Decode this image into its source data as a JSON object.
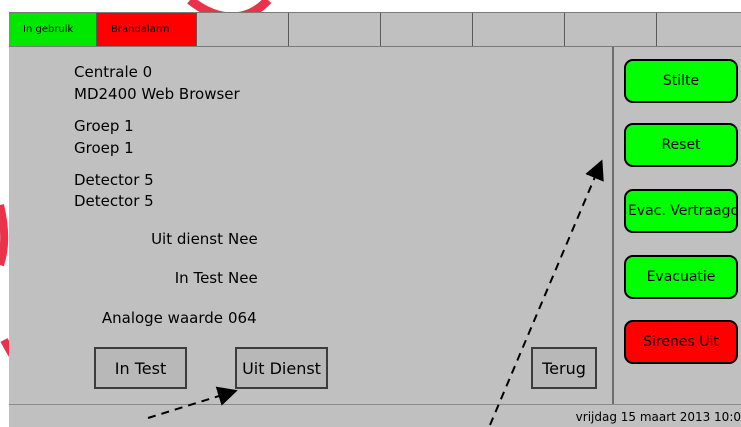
{
  "top_tabs": [
    {
      "label": "In gebruik",
      "color": "#00e800"
    },
    {
      "label": "Brandalarm",
      "color": "#ff0000"
    },
    {
      "label": ""
    },
    {
      "label": ""
    },
    {
      "label": ""
    },
    {
      "label": ""
    },
    {
      "label": ""
    },
    {
      "label": ""
    }
  ],
  "info": {
    "centrale": "Centrale 0",
    "browser": "MD2400 Web Browser",
    "group_line1": "Groep 1",
    "group_line2": "Groep 1",
    "detector_line1": "Detector 5",
    "detector_line2": "Detector 5"
  },
  "fields": {
    "uit_dienst_label": "Uit dienst",
    "uit_dienst_value": "Nee",
    "in_test_label": "In Test",
    "in_test_value": "Nee",
    "analoge_label": "Analoge waarde",
    "analoge_value": "064"
  },
  "buttons": {
    "in_test": "In Test",
    "uit_dienst": "Uit Dienst",
    "terug": "Terug"
  },
  "side_buttons": [
    {
      "label": "Stilte",
      "color": "#00ff00"
    },
    {
      "label": "Reset",
      "color": "#00ff00"
    },
    {
      "label": "Evac. Vertraagd",
      "color": "#00ff00"
    },
    {
      "label": "Evacuatie",
      "color": "#00ff00"
    },
    {
      "label": "Sirenes Uit",
      "color": "#ff0000"
    }
  ],
  "status": {
    "datetime": "vrijdag 15 maart 2013 10:0"
  }
}
